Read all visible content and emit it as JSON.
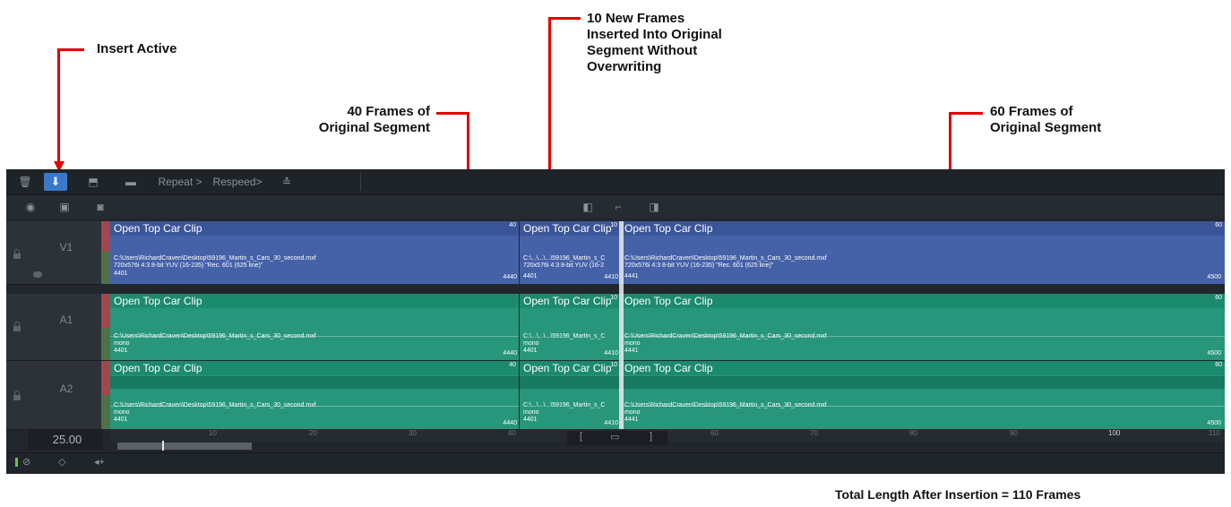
{
  "annotations": {
    "insert_active": "Insert Active",
    "new_frames": [
      "10 New Frames",
      "Inserted Into Original",
      "Segment Without",
      "Overwriting"
    ],
    "left_segment": [
      "40 Frames of",
      "Original Segment"
    ],
    "right_segment": [
      "60 Frames of",
      "Original Segment"
    ],
    "total": "Total Length After Insertion = 110 Frames"
  },
  "toolbar": {
    "repeat_label": "Repeat >",
    "respeed_label": "Respeed>"
  },
  "tracks": {
    "v1": "V1",
    "a1": "A1",
    "a2": "A2"
  },
  "clips": {
    "left": {
      "title": "Open Top Car Clip",
      "count": "40",
      "path": "C:\\Users\\RichardCraven\\Desktop\\59196_Martin_s_Cars_30_second.mxf",
      "video_format": "720x576i 4:3 8-bit YUV (16-235) \"Rec. 601 (625 line)\"",
      "audio_format": "mono",
      "start": "4401",
      "end": "4440"
    },
    "middle": {
      "title": "Open Top Car Clip",
      "count": "10",
      "path": "C:\\...\\...\\...\\59196_Martin_s_C",
      "video_format": "720x576i 4:3 8-bit YUV (16-2",
      "audio_format": "mono",
      "start": "4401",
      "end": "4410"
    },
    "right": {
      "title": "Open Top Car Clip",
      "count": "60",
      "path": "C:\\Users\\RichardCraven\\Desktop\\59196_Martin_s_Cars_30_second.mxf",
      "video_format": "720x576i 4:3 8-bit YUV (16-235) \"Rec. 601 (625 line)\"",
      "audio_format": "mono",
      "start": "4441",
      "end": "4500"
    }
  },
  "timeline": {
    "frame_rate": "25.00",
    "ruler_ticks": [
      "10",
      "20",
      "30",
      "40",
      "60",
      "70",
      "80",
      "90",
      "100",
      "110"
    ]
  },
  "icons": [
    "trash-icon",
    "insert-icon",
    "overwrite-icon",
    "camera-icon",
    "eye-icon",
    "monitor-icon",
    "snapshot-icon",
    "trim-left-icon",
    "trim-mid-icon",
    "trim-right-icon",
    "mark-in-icon",
    "mark-clip-icon",
    "mark-out-icon",
    "speaker-icon"
  ],
  "colors": {
    "annotation_red": "#e00000",
    "active_blue": "#3a79c9",
    "video_clip": "#4561a8",
    "audio_clip": "#27967a"
  }
}
